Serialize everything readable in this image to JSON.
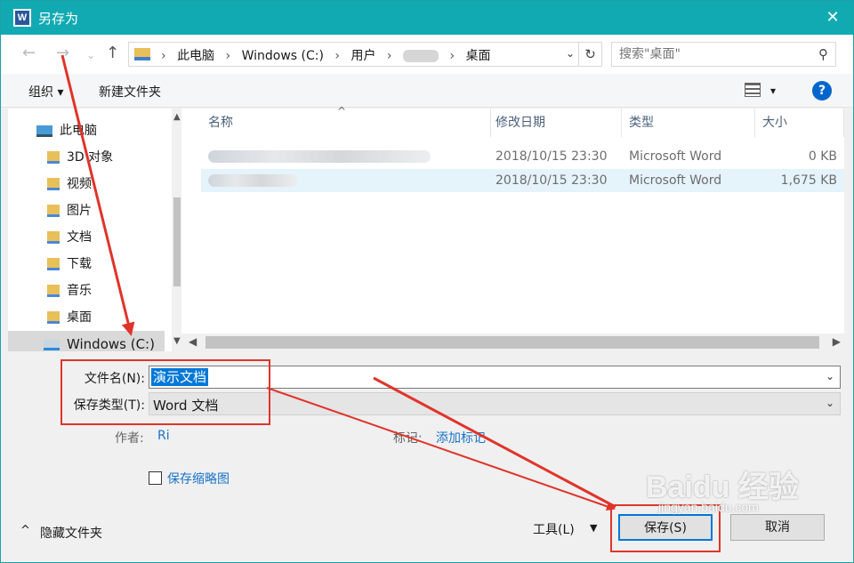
{
  "window": {
    "title": "另存为",
    "app_icon_letter": "W",
    "close_glyph": "✕"
  },
  "nav": {
    "back_glyph": "←",
    "forward_glyph": "→",
    "recent_glyph": "⌄",
    "up_glyph": "↑"
  },
  "address": {
    "crumbs": [
      "此电脑",
      "Windows (C:)",
      "用户",
      "桌面"
    ],
    "separator": "›",
    "dropdown_glyph": "⌄",
    "refresh_glyph": "↻"
  },
  "search": {
    "placeholder": "搜索\"桌面\"",
    "icon": "search-icon"
  },
  "toolbar": {
    "organize_label": "组织 ▾",
    "new_folder_label": "新建文件夹",
    "view_dropdown_glyph": "▾",
    "help_glyph": "?"
  },
  "sidebar": {
    "items": [
      {
        "label": "此电脑",
        "icon": "computer-icon"
      },
      {
        "label": "3D 对象",
        "icon": "3d-objects-icon"
      },
      {
        "label": "视频",
        "icon": "videos-icon"
      },
      {
        "label": "图片",
        "icon": "pictures-icon"
      },
      {
        "label": "文档",
        "icon": "documents-icon"
      },
      {
        "label": "下载",
        "icon": "downloads-icon"
      },
      {
        "label": "音乐",
        "icon": "music-icon"
      },
      {
        "label": "桌面",
        "icon": "desktop-icon"
      },
      {
        "label": "Windows (C:)",
        "icon": "drive-icon"
      }
    ],
    "selected_index": 8
  },
  "files": {
    "columns": [
      "名称",
      "修改日期",
      "类型",
      "大小"
    ],
    "sort_caret": "^",
    "rows": [
      {
        "name": "",
        "modified": "2018/10/15 23:30",
        "type": "Microsoft Word",
        "size": "0 KB",
        "selected": false
      },
      {
        "name": "",
        "modified": "2018/10/15 23:30",
        "type": "Microsoft Word",
        "size": "1,675 KB",
        "selected": true
      }
    ]
  },
  "form": {
    "filename_label": "文件名(N):",
    "filename_value": "演示文档",
    "filetype_label": "保存类型(T):",
    "filetype_value": "Word 文档",
    "author_label": "作者:",
    "author_value": "Ri",
    "tags_label": "标记:",
    "tags_value": "添加标记",
    "thumbnail_label": "保存缩略图"
  },
  "bottom": {
    "hide_folders_label": "隐藏文件夹",
    "hide_folders_glyph": "^",
    "tools_label": "工具(L)",
    "tools_dropdown_glyph": "▼",
    "save_label": "保存(S)",
    "cancel_label": "取消"
  },
  "watermark": {
    "brand": "Baidu 经验",
    "url": "jingyan.baidu.com"
  },
  "colors": {
    "titlebar": "#11aab2",
    "selection": "#0078d7",
    "annotation": "#e0342a",
    "link": "#1a73c7"
  }
}
